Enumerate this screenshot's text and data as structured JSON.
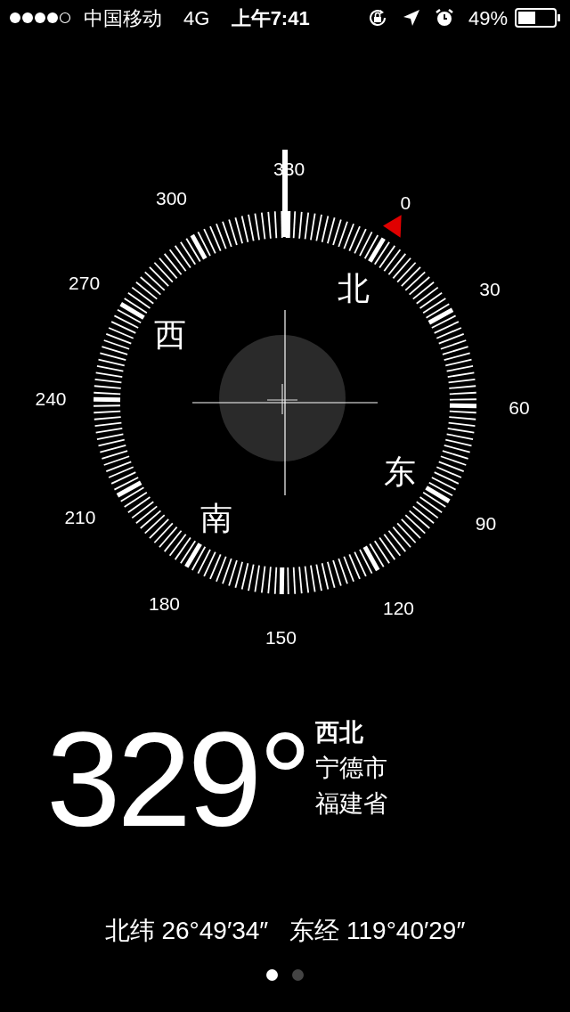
{
  "status_bar": {
    "carrier": "中国移动",
    "network": "4G",
    "time": "上午7:41",
    "battery_percent": "49%"
  },
  "compass": {
    "dial_labels": [
      "0",
      "30",
      "60",
      "90",
      "120",
      "150",
      "180",
      "210",
      "240",
      "270",
      "300",
      "330"
    ],
    "cardinals": [
      "北",
      "东",
      "南",
      "西"
    ]
  },
  "reading": {
    "degrees": "329°",
    "direction": "西北",
    "city": "宁德市",
    "province": "福建省"
  },
  "coordinates": {
    "latitude": "北纬 26°49′34″",
    "longitude": "东经 119°40′29″"
  },
  "page_dots": [
    {
      "selected": true
    },
    {
      "selected": false
    }
  ]
}
